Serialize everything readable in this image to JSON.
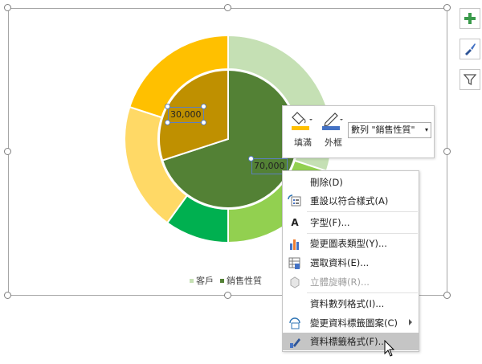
{
  "chart_data": {
    "type": "donut",
    "series": [
      {
        "name": "客戶",
        "ring": "outer",
        "values": [
          30,
          20,
          10,
          20,
          20
        ],
        "colors": [
          "#c5e0b4",
          "#92d050",
          "#00b050",
          "#ffd966",
          "#ffc000"
        ]
      },
      {
        "name": "銷售性質",
        "ring": "inner",
        "values": [
          70000,
          30000
        ],
        "labels": [
          "70,000",
          "30,000"
        ],
        "colors": [
          "#538135",
          "#bf9000"
        ]
      }
    ],
    "legend": [
      {
        "label": "客戶",
        "color": "#c5e0b4"
      },
      {
        "label": "銷售性質",
        "color": "#538135"
      }
    ],
    "legend_position": "bottom"
  },
  "toolbar": {
    "fill_label": "填滿",
    "outline_label": "外框",
    "series_select": "數列 \"銷售性質\"",
    "fill_color": "#ffc000",
    "outline_color": "#4472c4"
  },
  "side_buttons": [
    {
      "name": "chart-elements-button",
      "icon": "plus-icon"
    },
    {
      "name": "chart-styles-button",
      "icon": "brush-icon"
    },
    {
      "name": "chart-filters-button",
      "icon": "filter-icon"
    }
  ],
  "context_menu": {
    "items": [
      {
        "label": "刪除(D)",
        "icon": ""
      },
      {
        "label": "重設以符合樣式(A)",
        "icon": "reset-style-icon"
      },
      {
        "label": "字型(F)...",
        "icon": "font-icon"
      },
      {
        "label": "變更圖表類型(Y)...",
        "icon": "chart-type-icon"
      },
      {
        "label": "選取資料(E)...",
        "icon": "select-data-icon"
      },
      {
        "label": "立體旋轉(R)...",
        "icon": "3d-rotation-icon",
        "disabled": true
      },
      {
        "label": "資料數列格式(I)...",
        "icon": ""
      },
      {
        "label": "變更資料標籤圖案(C)",
        "icon": "label-shape-icon",
        "submenu": true
      },
      {
        "label": "資料標籤格式(F)...",
        "icon": "format-label-icon",
        "hover": true
      }
    ],
    "font_glyph": "A"
  }
}
